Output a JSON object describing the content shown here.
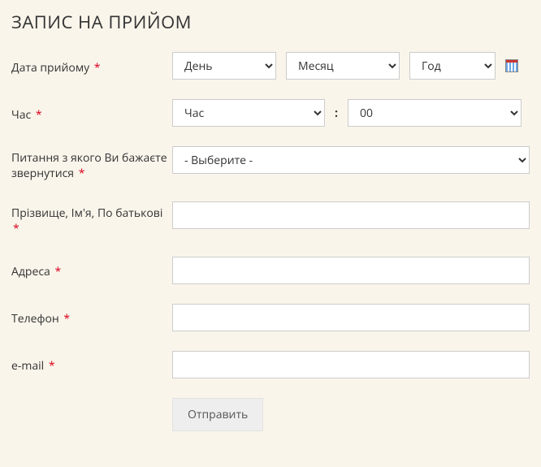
{
  "title": "ЗАПИС НА ПРИЙОМ",
  "required_marker": "*",
  "fields": {
    "date": {
      "label": "Дата прийому",
      "day_selected": "День",
      "month_selected": "Месяц",
      "year_selected": "Год"
    },
    "time": {
      "label": "Час",
      "hour_selected": "Час",
      "minute_selected": "00",
      "separator": ":"
    },
    "topic": {
      "label": "Питання з якого Ви бажаєте звернутися",
      "selected": "- Выберите -"
    },
    "fullname": {
      "label": "Прізвище, Ім'я, По батькові",
      "value": ""
    },
    "address": {
      "label": "Адреса",
      "value": ""
    },
    "phone": {
      "label": "Телефон",
      "value": ""
    },
    "email": {
      "label": "e-mail",
      "value": ""
    }
  },
  "submit_label": "Отправить"
}
